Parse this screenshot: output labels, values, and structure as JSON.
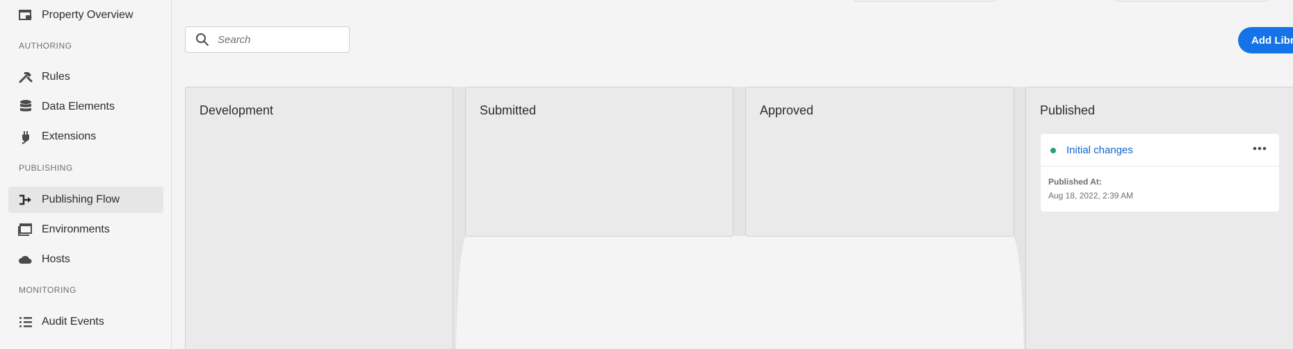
{
  "sidebar": {
    "items": [
      {
        "label": "Property Overview",
        "icon": "property-icon"
      },
      {
        "label": "Rules",
        "icon": "hammer-icon"
      },
      {
        "label": "Data Elements",
        "icon": "database-icon"
      },
      {
        "label": "Extensions",
        "icon": "plug-icon"
      },
      {
        "label": "Publishing Flow",
        "icon": "publishing-flow-icon",
        "active": true
      },
      {
        "label": "Environments",
        "icon": "environments-icon"
      },
      {
        "label": "Hosts",
        "icon": "cloud-icon"
      },
      {
        "label": "Audit Events",
        "icon": "list-icon"
      }
    ],
    "sections": {
      "authoring": "AUTHORING",
      "publishing": "PUBLISHING",
      "monitoring": "MONITORING"
    }
  },
  "toolbar": {
    "search_placeholder": "Search",
    "add_library_label": "Add Library"
  },
  "board": {
    "columns": [
      {
        "title": "Development"
      },
      {
        "title": "Submitted"
      },
      {
        "title": "Approved"
      },
      {
        "title": "Published"
      }
    ],
    "published_libraries": [
      {
        "name": "Initial changes",
        "status_color": "#2d9d78",
        "published_at_label": "Published At:",
        "published_at": "Aug 18, 2022, 2:39 AM"
      }
    ]
  },
  "colors": {
    "accent": "#1473e6",
    "link": "#0d66d0",
    "status_published": "#2d9d78"
  }
}
